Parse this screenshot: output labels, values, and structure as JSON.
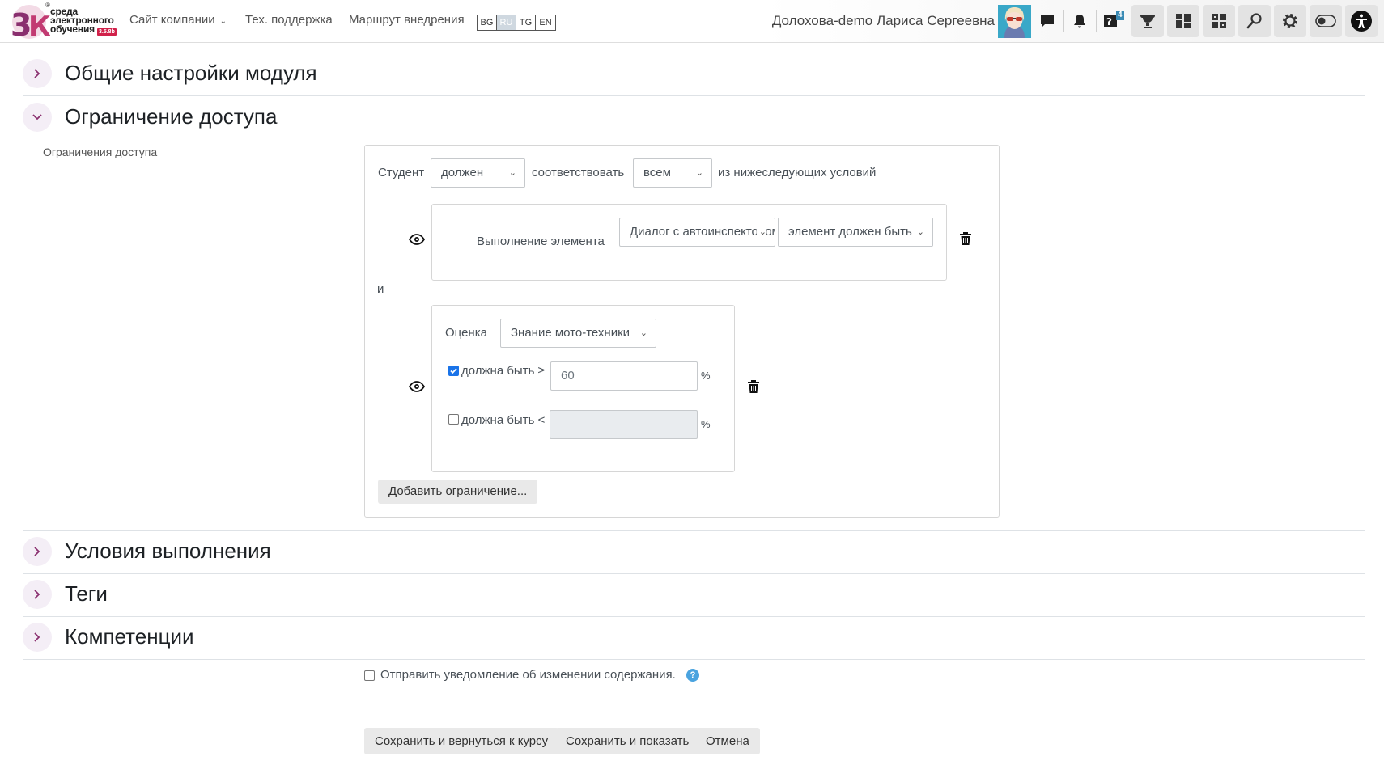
{
  "navbar": {
    "logo": {
      "text_line1": "среда",
      "text_line2": "электронного",
      "text_line3": "обучения",
      "version": "3.5.8b",
      "mark": "3К"
    },
    "links": [
      {
        "label": "Сайт компании",
        "has_dropdown": true
      },
      {
        "label": "Тех. поддержка"
      },
      {
        "label": "Маршрут внедрения"
      }
    ],
    "languages": [
      {
        "code": "BG",
        "active": false
      },
      {
        "code": "RU",
        "active": true
      },
      {
        "code": "TG",
        "active": false
      },
      {
        "code": "EN",
        "active": false
      }
    ],
    "user_name": "Долохова-demo Лариса Сергеевна",
    "icons": [
      "message-icon",
      "bell-icon",
      "question-icon",
      "trophy-icon",
      "dashboard-icon",
      "puzzle-icon",
      "search-icon",
      "gear-icon",
      "toggle-icon",
      "accessibility-icon"
    ],
    "question_badge": "4"
  },
  "sections": {
    "general": {
      "title": "Общие настройки модуля",
      "expanded": false
    },
    "access": {
      "title": "Ограничение доступа",
      "expanded": true,
      "field_label": "Ограничения доступа"
    },
    "completion": {
      "title": "Условия выполнения",
      "expanded": false
    },
    "tags": {
      "title": "Теги",
      "expanded": false
    },
    "competencies": {
      "title": "Компетенции",
      "expanded": false
    }
  },
  "restriction": {
    "student_label": "Студент",
    "must_select": "должен",
    "match_label": "соответствовать",
    "all_select": "всем",
    "conditions_label": "из нижеследующих условий",
    "and_label": "и",
    "condition1": {
      "label": "Выполнение элемента",
      "activity_select": "Диалог с автоинспектором",
      "state_select": "элемент должен быть"
    },
    "condition2": {
      "label": "Оценка",
      "grade_select": "Знание мото-техники",
      "min_label": "должна быть ≥",
      "min_checked": true,
      "min_value": "60",
      "max_label": "должна быть <",
      "max_checked": false,
      "max_value": "",
      "percent": "%"
    },
    "add_button": "Добавить ограничение..."
  },
  "notify": {
    "label": "Отправить уведомление об изменении содержания.",
    "checked": false
  },
  "footer": {
    "save_return": "Сохранить и вернуться к курсу",
    "save_show": "Сохранить и показать",
    "cancel": "Отмена"
  },
  "colors": {
    "accent": "#8a2f6f",
    "toggle_bg": "#f4eef6",
    "checkbox": "#1a73e8",
    "help": "#4aa3df"
  }
}
